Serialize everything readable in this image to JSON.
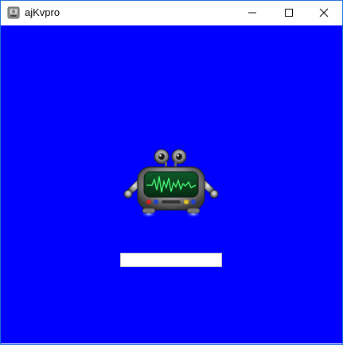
{
  "window": {
    "title": "ajKvpro",
    "app_icon": "app-disk-icon",
    "controls": {
      "minimize_icon": "minimize-icon",
      "maximize_icon": "maximize-icon",
      "close_icon": "close-icon"
    }
  },
  "client": {
    "background_color": "#0000ff",
    "mascot": "robot-mascot-icon",
    "input": {
      "value": "",
      "placeholder": ""
    }
  },
  "colors": {
    "accent_border": "#1e6fd6",
    "client_bg": "#0000ff",
    "input_bg": "#ffffff"
  }
}
